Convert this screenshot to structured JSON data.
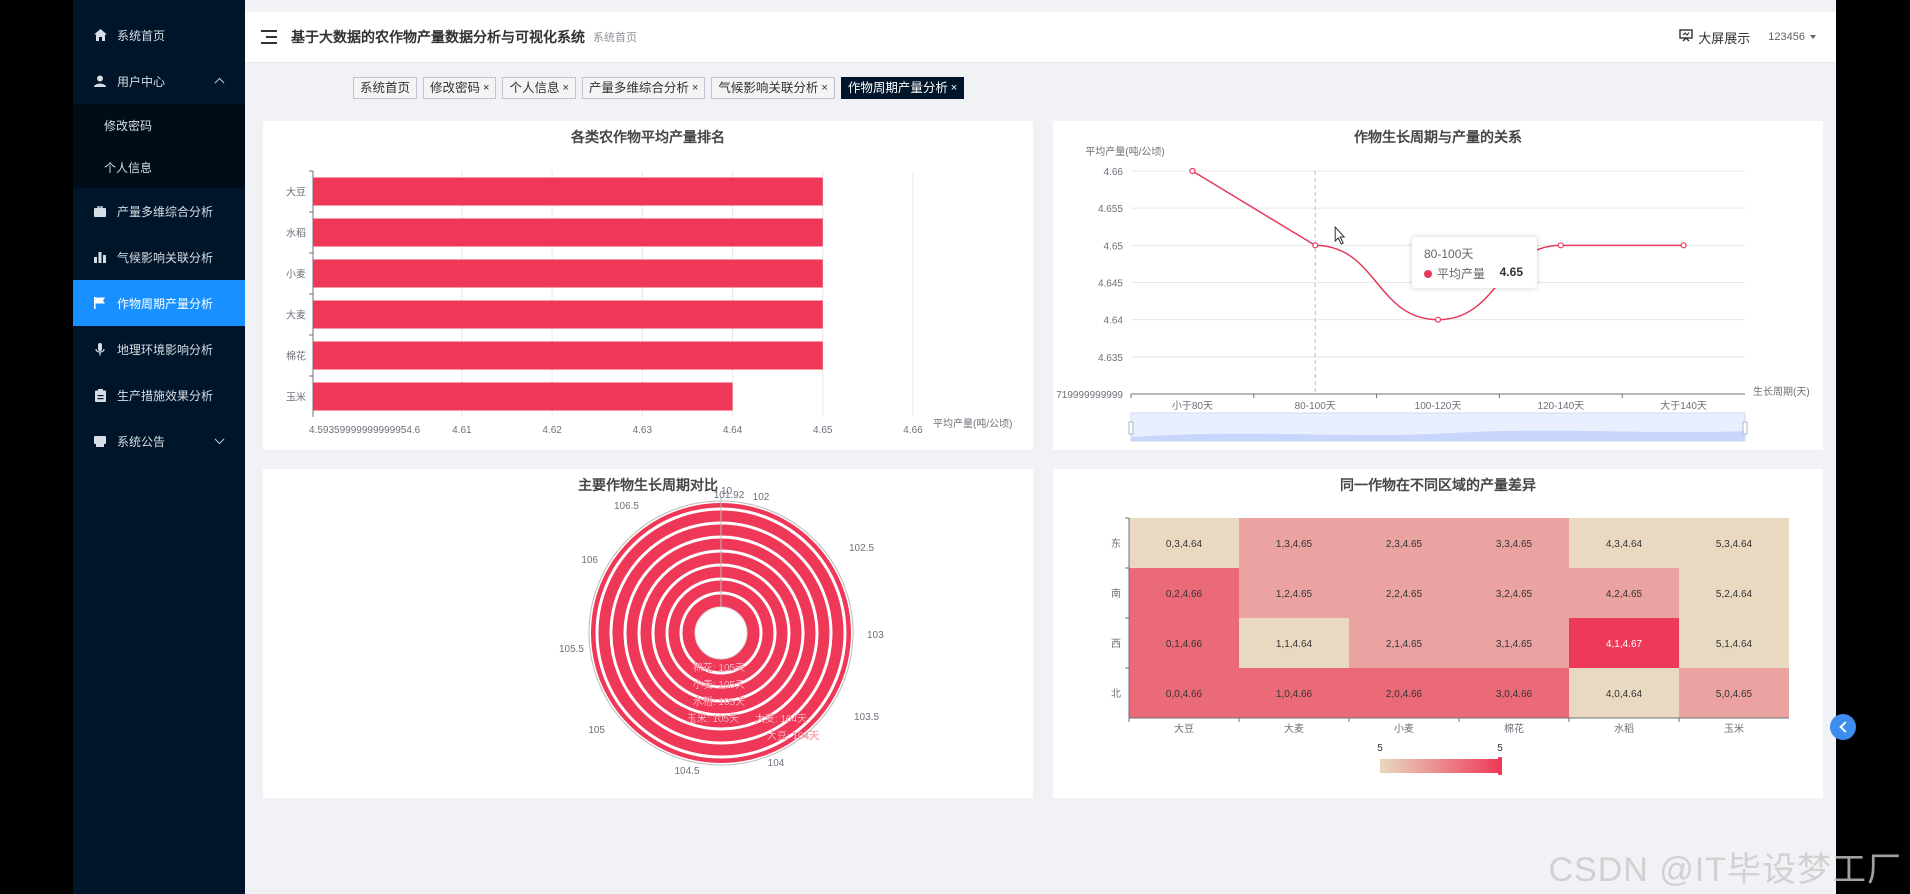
{
  "app": {
    "title": "基于大数据的农作物产量数据分析与可视化系统",
    "breadcrumb": "系统首页",
    "bigscreen_label": "大屏展示",
    "user": "123456"
  },
  "menu": {
    "home": "系统首页",
    "user_center": "用户中心",
    "user_sub": [
      "修改密码",
      "个人信息"
    ],
    "items": [
      "产量多维综合分析",
      "气候影响关联分析",
      "作物周期产量分析",
      "地理环境影响分析",
      "生产措施效果分析"
    ],
    "notice": "系统公告"
  },
  "tags": [
    {
      "label": "系统首页",
      "close": ""
    },
    {
      "label": "修改密码",
      "close": "×"
    },
    {
      "label": "个人信息",
      "close": "×"
    },
    {
      "label": "产量多维综合分析",
      "close": "×"
    },
    {
      "label": "气候影响关联分析",
      "close": "×"
    },
    {
      "label": "作物周期产量分析",
      "close": "×"
    }
  ],
  "chart_data": [
    {
      "type": "bar",
      "title": "各类农作物平均产量排名",
      "categories": [
        "大豆",
        "水稻",
        "小麦",
        "大麦",
        "棉花",
        "玉米"
      ],
      "values": [
        4.65,
        4.65,
        4.65,
        4.65,
        4.65,
        4.64
      ],
      "xlim": [
        4.5935,
        4.66
      ],
      "xticks": [
        "4.59359999999999954.6",
        "4.61",
        "4.62",
        "4.63",
        "4.64",
        "4.65",
        "4.66"
      ],
      "xlabel": "平均产量(吨/公顷)"
    },
    {
      "type": "line",
      "title": "作物生长周期与产量的关系",
      "categories": [
        "小于80天",
        "80-100天",
        "100-120天",
        "120-140天",
        "大于140天"
      ],
      "values": [
        4.66,
        4.65,
        4.64,
        4.65,
        4.65
      ],
      "ylim": [
        4.63,
        4.66
      ],
      "yticks": [
        "4.66",
        "4.655",
        "4.65",
        "4.645",
        "4.64",
        "4.635"
      ],
      "ymin_label": "719999999999",
      "ylabel": "平均产量(吨/公顷)",
      "xlabel": "生长周期(天)",
      "tooltip": {
        "title": "80-100天",
        "series": "平均产量",
        "value": "4.65"
      }
    },
    {
      "type": "polar-bar",
      "title": "主要作物生长周期对比",
      "ticks": [
        "10",
        "101.92",
        "102",
        "102.5",
        "103",
        "103.5",
        "104",
        "104.5",
        "105",
        "105.5",
        "106",
        "106.5"
      ],
      "labels": [
        "棉花: 105天",
        "小麦: 105天",
        "水稻: 105天",
        "玉米: 105天",
        "大麦: 104天",
        "大豆: 104天"
      ]
    },
    {
      "type": "heatmap",
      "title": "同一作物在不同区域的产量差异",
      "x": [
        "大豆",
        "大麦",
        "小麦",
        "棉花",
        "水稻",
        "玉米"
      ],
      "y": [
        "东",
        "南",
        "西",
        "北"
      ],
      "cells": [
        [
          "0,3,4.64",
          "1,3,4.65",
          "2,3,4.65",
          "3,3,4.65",
          "4,3,4.64",
          "5,3,4.64"
        ],
        [
          "0,2,4.66",
          "1,2,4.65",
          "2,2,4.65",
          "3,2,4.65",
          "4,2,4.65",
          "5,2,4.64"
        ],
        [
          "0,1,4.66",
          "1,1,4.64",
          "2,1,4.65",
          "3,1,4.65",
          "4,1,4.67",
          "5,1,4.64"
        ],
        [
          "0,0,4.66",
          "1,0,4.66",
          "2,0,4.66",
          "3,0,4.66",
          "4,0,4.64",
          "5,0,4.65"
        ]
      ],
      "visualmap": {
        "min_label": "5",
        "max_label": "5"
      }
    }
  ]
}
